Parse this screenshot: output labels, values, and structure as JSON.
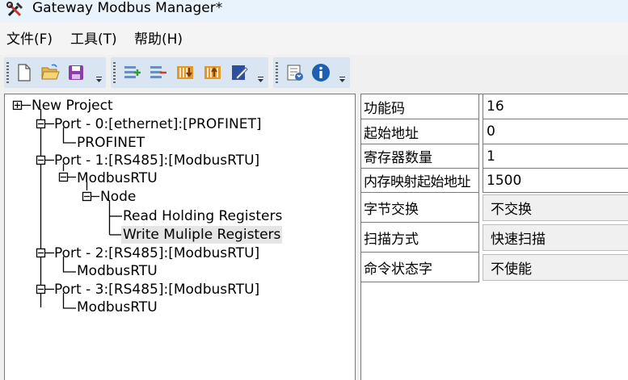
{
  "window": {
    "title": "Gateway Modbus Manager*",
    "icon": "wrench-hammer-icon"
  },
  "menu": {
    "items": [
      {
        "label": "文件(F)"
      },
      {
        "label": "工具(T)"
      },
      {
        "label": "帮助(H)"
      }
    ]
  },
  "toolbar": {
    "groups": [
      {
        "buttons": [
          "new-file-icon",
          "open-folder-icon",
          "save-icon"
        ]
      },
      {
        "buttons": [
          "add-command-icon",
          "remove-command-icon",
          "download-icon",
          "upload-icon",
          "edit-note-icon"
        ]
      },
      {
        "buttons": [
          "config-report-icon",
          "info-icon"
        ]
      }
    ]
  },
  "tree": {
    "nodes": [
      {
        "label": "New Project"
      },
      {
        "label": "Port - 0:[ethernet]:[PROFINET]"
      },
      {
        "label": "PROFINET"
      },
      {
        "label": "Port - 1:[RS485]:[ModbusRTU]"
      },
      {
        "label": "ModbusRTU"
      },
      {
        "label": "Node"
      },
      {
        "label": "Read Holding Registers"
      },
      {
        "label": "Write Muliple Registers"
      },
      {
        "label": "Port - 2:[RS485]:[ModbusRTU]"
      },
      {
        "label": "ModbusRTU"
      },
      {
        "label": "Port - 3:[RS485]:[ModbusRTU]"
      },
      {
        "label": "ModbusRTU"
      }
    ]
  },
  "properties": {
    "rows": [
      {
        "name": "功能码",
        "value": "16"
      },
      {
        "name": "起始地址",
        "value": "0"
      },
      {
        "name": "寄存器数量",
        "value": "1"
      },
      {
        "name": "内存映射起始地址",
        "value": "1500"
      },
      {
        "name": "字节交换",
        "value": "不交换"
      },
      {
        "name": "扫描方式",
        "value": "快速扫描"
      },
      {
        "name": "命令状态字",
        "value": "不使能"
      }
    ]
  }
}
